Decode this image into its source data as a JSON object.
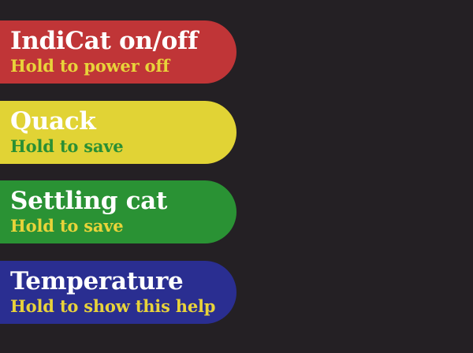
{
  "buttons": [
    {
      "title": "IndiCat on/off",
      "hint": "Hold to power off",
      "bg": "#c03537",
      "hint_color": "#e8d33a"
    },
    {
      "title": "Quack",
      "hint": "Hold to save",
      "bg": "#e1d335",
      "hint_color": "#2a8f34"
    },
    {
      "title": "Settling cat",
      "hint": "Hold to save",
      "bg": "#2a9234",
      "hint_color": "#e8d33a"
    },
    {
      "title": "Temperature",
      "hint": "Hold to show this help",
      "bg": "#2a2e91",
      "hint_color": "#e8d33a"
    }
  ]
}
